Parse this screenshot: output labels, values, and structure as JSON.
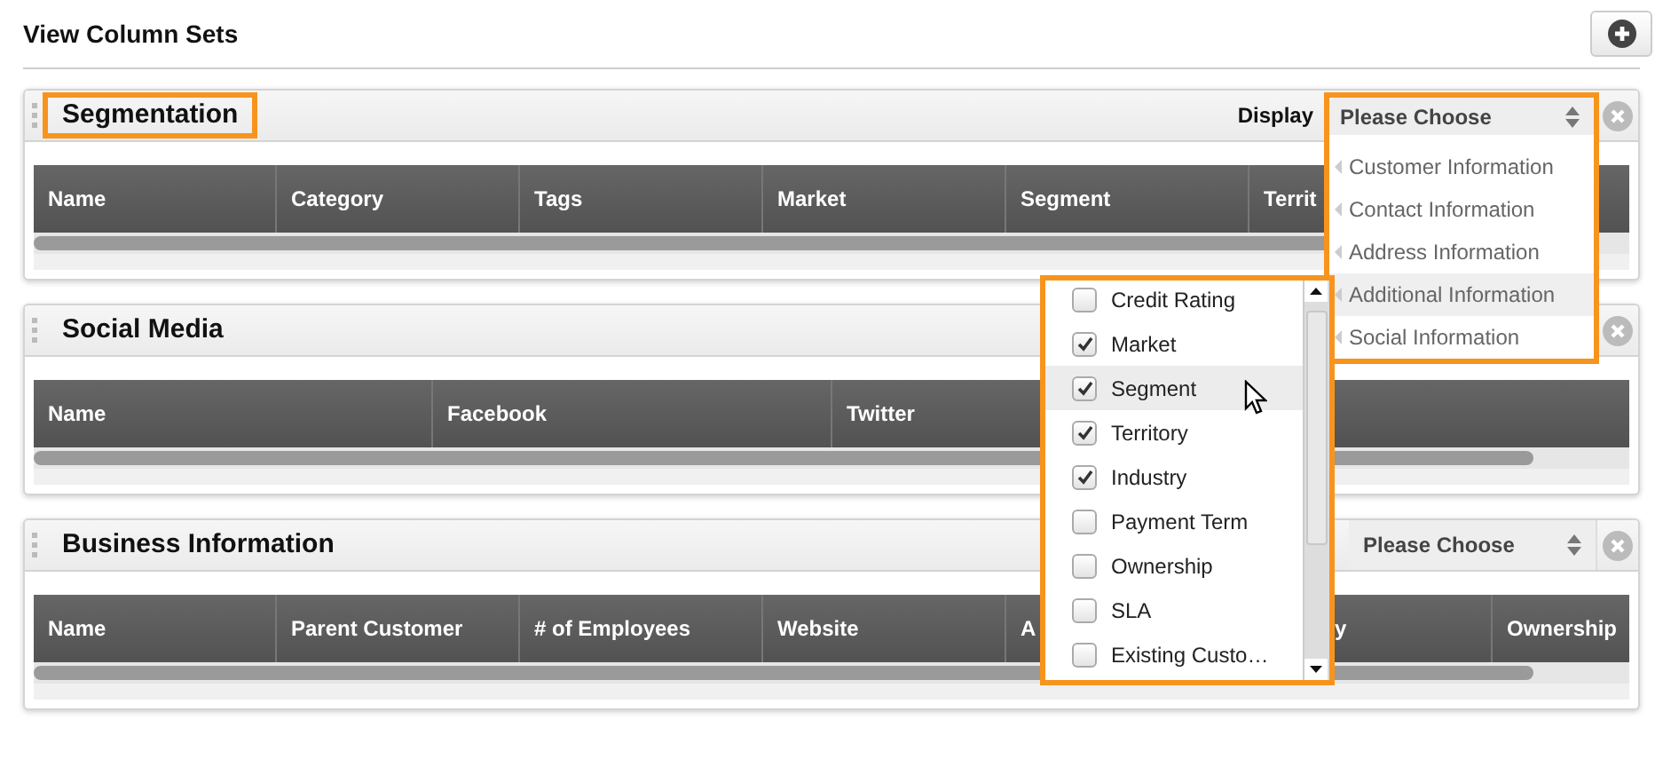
{
  "page": {
    "title": "View Column Sets"
  },
  "panels": [
    {
      "title": "Segmentation",
      "highlighted": true,
      "display_label": "Display",
      "columns": [
        {
          "label": "Name"
        },
        {
          "label": "Category"
        },
        {
          "label": "Tags"
        },
        {
          "label": "Market"
        },
        {
          "label": "Segment"
        },
        {
          "label": "Territ"
        }
      ]
    },
    {
      "title": "Social Media",
      "highlighted": false,
      "columns": [
        {
          "label": "Name"
        },
        {
          "label": "Facebook"
        },
        {
          "label": "Twitter"
        }
      ]
    },
    {
      "title": "Business Information",
      "highlighted": false,
      "select": {
        "value": "Please Choose"
      },
      "columns": [
        {
          "label": "Name"
        },
        {
          "label": "Parent Customer"
        },
        {
          "label": "# of Employees"
        },
        {
          "label": "Website"
        },
        {
          "label": "A"
        },
        {
          "label": "y",
          "kind": "partial"
        },
        {
          "label": "Ownership"
        }
      ]
    }
  ],
  "dropdown": {
    "value": "Please Choose",
    "options": [
      {
        "label": "Customer Information",
        "highlighted": false
      },
      {
        "label": "Contact Information",
        "highlighted": false
      },
      {
        "label": "Address Information",
        "highlighted": false
      },
      {
        "label": "Additional Information",
        "highlighted": true
      },
      {
        "label": "Social Information",
        "highlighted": false
      }
    ]
  },
  "column_picker": {
    "items": [
      {
        "label": "Credit Rating",
        "checked": false,
        "highlighted": false
      },
      {
        "label": "Market",
        "checked": true,
        "highlighted": false
      },
      {
        "label": "Segment",
        "checked": true,
        "highlighted": true
      },
      {
        "label": "Territory",
        "checked": true,
        "highlighted": false
      },
      {
        "label": "Industry",
        "checked": true,
        "highlighted": false
      },
      {
        "label": "Payment Term",
        "checked": false,
        "highlighted": false
      },
      {
        "label": "Ownership",
        "checked": false,
        "highlighted": false
      },
      {
        "label": "SLA",
        "checked": false,
        "highlighted": false
      },
      {
        "label": "Existing Custo…",
        "checked": false,
        "highlighted": false
      }
    ]
  }
}
